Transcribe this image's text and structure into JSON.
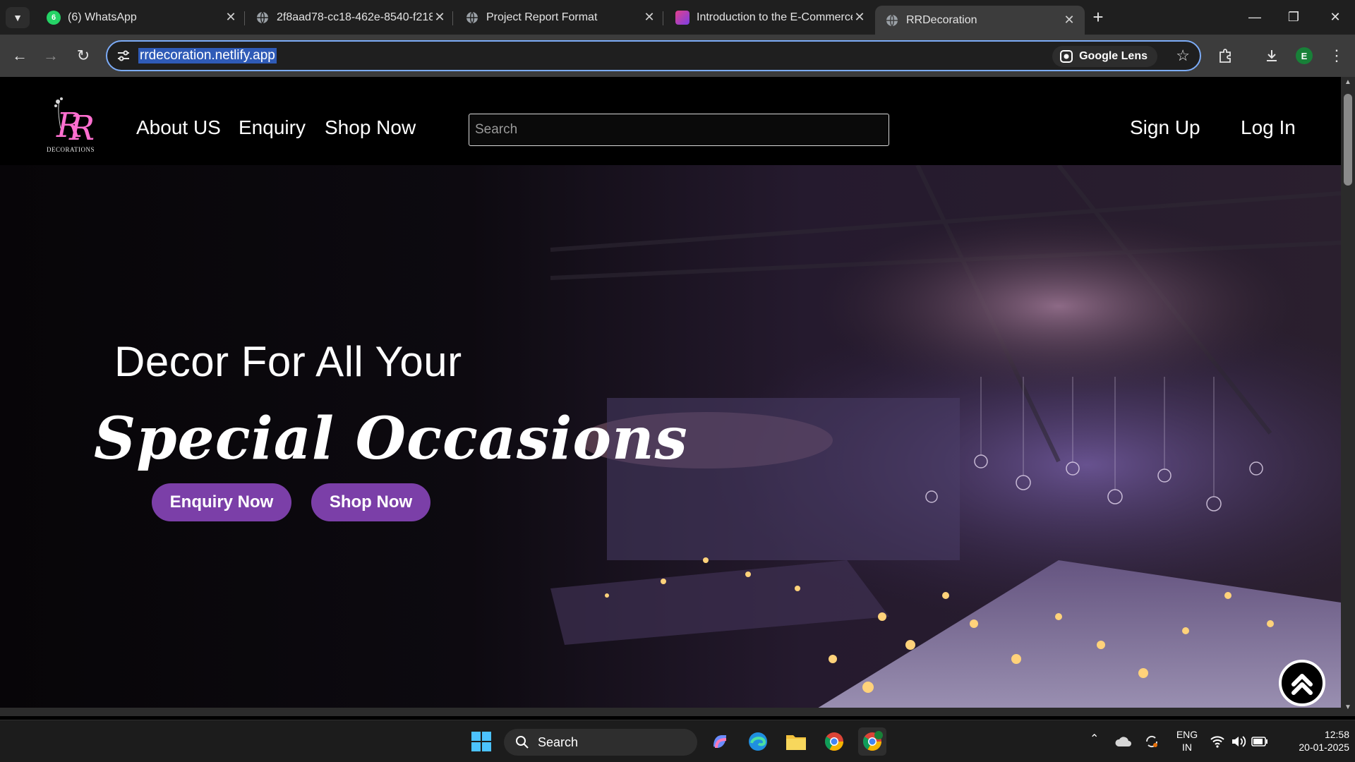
{
  "browser": {
    "tabs": [
      {
        "title": "(6) WhatsApp",
        "badge": "6",
        "active": false
      },
      {
        "title": "2f8aad78-cc18-462e-8540-f218",
        "active": false
      },
      {
        "title": "Project Report Format",
        "active": false
      },
      {
        "title": "Introduction to the E-Commerce",
        "active": false
      },
      {
        "title": "RRDecoration",
        "active": true
      }
    ],
    "url": "rrdecoration.netlify.app",
    "lens_label": "Google Lens",
    "profile_initial": "E"
  },
  "site": {
    "logo_text": "DECORATIONS",
    "nav": {
      "about": "About US",
      "enquiry": "Enquiry",
      "shop": "Shop Now"
    },
    "search_placeholder": "Search",
    "auth": {
      "signup": "Sign Up",
      "login": "Log In"
    },
    "hero": {
      "line1": "Decor For All Your",
      "line2": "Special Occasions",
      "btn_enquiry": "Enquiry Now",
      "btn_shop": "Shop Now"
    }
  },
  "taskbar": {
    "search_label": "Search",
    "lang": "ENG",
    "region": "IN",
    "time": "12:58",
    "date": "20-01-2025"
  },
  "colors": {
    "accent": "#7b3fa8",
    "url_highlight": "#2f5bb7"
  }
}
